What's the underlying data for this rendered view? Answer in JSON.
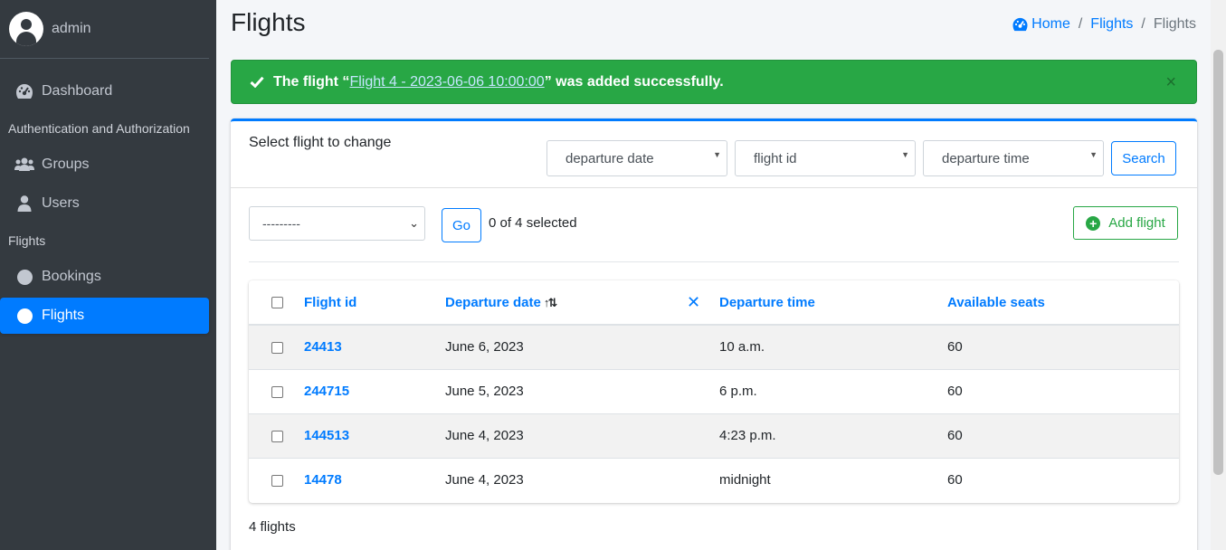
{
  "sidebar": {
    "user": "admin",
    "dashboard": "Dashboard",
    "auth_header": "Authentication and Authorization",
    "groups": "Groups",
    "users": "Users",
    "flights_header": "Flights",
    "bookings": "Bookings",
    "flights": "Flights"
  },
  "header": {
    "title": "Flights",
    "breadcrumb": [
      "Home",
      "Flights",
      "Flights"
    ]
  },
  "alert": {
    "prefix": "The flight “",
    "link": "Flight 4 - 2023-06-06 10:00:00",
    "suffix": "” was added successfully.",
    "close": "×"
  },
  "filters": {
    "title": "Select flight to change",
    "departure_date": "departure date",
    "flight_id": "flight id",
    "departure_time": "departure time",
    "search": "Search"
  },
  "actions": {
    "select_value": "---------",
    "go": "Go",
    "selected": "0 of 4 selected",
    "add": "Add flight"
  },
  "table": {
    "columns": [
      "Flight id",
      "Departure date",
      "Departure time",
      "Available seats"
    ],
    "clear_sort": "✕",
    "rows": [
      {
        "id": "24413",
        "date": "June 6, 2023",
        "time": "10 a.m.",
        "seats": "60"
      },
      {
        "id": "244715",
        "date": "June 5, 2023",
        "time": "6 p.m.",
        "seats": "60"
      },
      {
        "id": "144513",
        "date": "June 4, 2023",
        "time": "4:23 p.m.",
        "seats": "60"
      },
      {
        "id": "14478",
        "date": "June 4, 2023",
        "time": "midnight",
        "seats": "60"
      }
    ]
  },
  "footer": {
    "count": "4 flights"
  },
  "colors": {
    "primary": "#007bff",
    "success": "#28a745",
    "sidebar": "#343a40"
  }
}
